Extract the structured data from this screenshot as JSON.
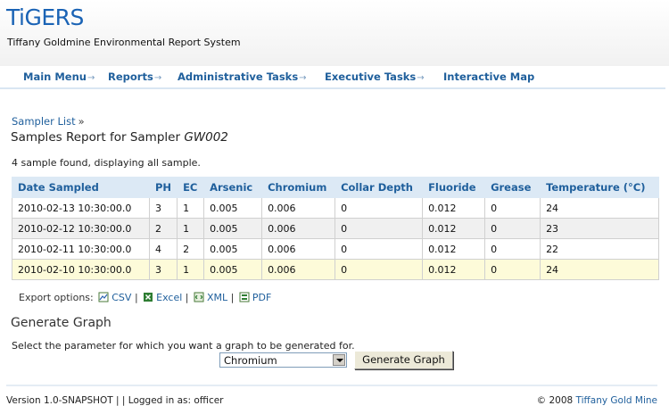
{
  "app": {
    "logo": "TiGERS",
    "subtitle": "Tiffany Goldmine Environmental Report System"
  },
  "nav": {
    "items": [
      {
        "label": "Main Menu",
        "arrow": "→"
      },
      {
        "label": "Reports",
        "arrow": "→"
      },
      {
        "label": "Administrative Tasks",
        "arrow": "→"
      },
      {
        "label": "Executive Tasks",
        "arrow": "→"
      },
      {
        "label": "Interactive Map",
        "arrow": ""
      }
    ]
  },
  "breadcrumb": {
    "link": "Sampler List",
    "sep": "»"
  },
  "page": {
    "title_prefix": "Samples Report for Sampler ",
    "sampler_id": "GW002",
    "summary": "4 sample found, displaying all sample."
  },
  "table": {
    "headers": [
      "Date Sampled",
      "PH",
      "EC",
      "Arsenic",
      "Chromium",
      "Collar Depth",
      "Fluoride",
      "Grease",
      "Temperature (°C)"
    ],
    "rows": [
      [
        "2010-02-13 10:30:00.0",
        "3",
        "1",
        "0.005",
        "0.006",
        "0",
        "0.012",
        "0",
        "24"
      ],
      [
        "2010-02-12 10:30:00.0",
        "2",
        "1",
        "0.005",
        "0.006",
        "0",
        "0.012",
        "0",
        "23"
      ],
      [
        "2010-02-11 10:30:00.0",
        "4",
        "2",
        "0.005",
        "0.006",
        "0",
        "0.012",
        "0",
        "22"
      ],
      [
        "2010-02-10 10:30:00.0",
        "3",
        "1",
        "0.005",
        "0.006",
        "0",
        "0.012",
        "0",
        "24"
      ]
    ]
  },
  "export": {
    "label": "Export options:",
    "csv": "CSV",
    "excel": "Excel",
    "xml": "XML",
    "pdf": "PDF",
    "sep": "|"
  },
  "graph": {
    "title": "Generate Graph",
    "hint": "Select the parameter for which you want a graph to be generated for.",
    "selected": "Chromium",
    "button": "Generate Graph"
  },
  "footer": {
    "version": "Version 1.0-SNAPSHOT | | Logged in as: officer",
    "copyright": "© 2008 ",
    "company": "Tiffany Gold Mine"
  },
  "colors": {
    "link": "#1f5f9c",
    "logo": "#1a63b5",
    "header_row": "#dce9f5",
    "highlight_row": "#fdfbd9"
  }
}
